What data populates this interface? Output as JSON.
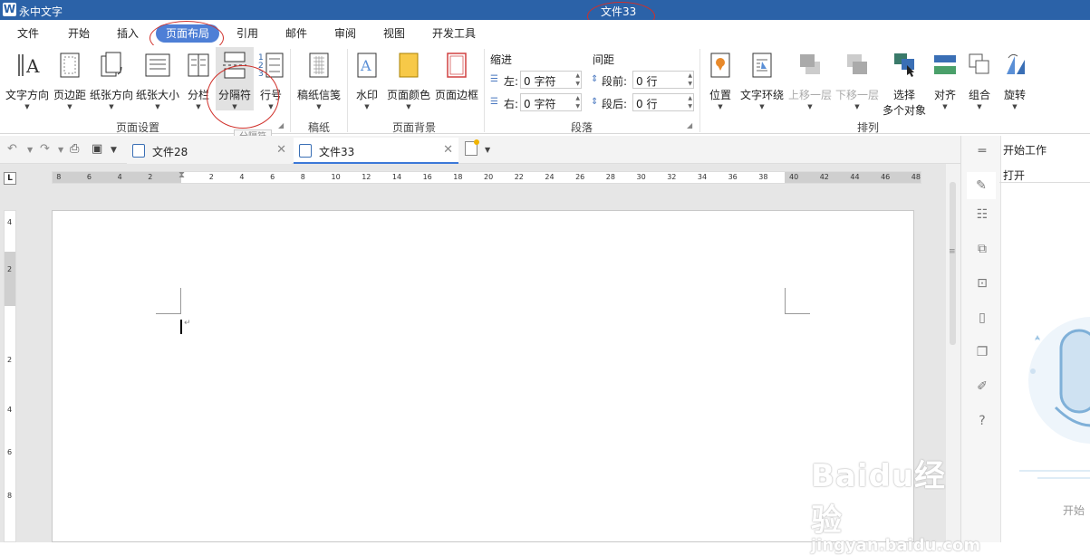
{
  "app": {
    "logo": "W",
    "name": "永中文字",
    "title": "文件33"
  },
  "menu": [
    "文件",
    "开始",
    "插入",
    "页面布局",
    "引用",
    "邮件",
    "审阅",
    "视图",
    "开发工具"
  ],
  "ribbon": {
    "page_setup": {
      "buttons": [
        "文字方向",
        "页边距",
        "纸张方向",
        "纸张大小",
        "分栏",
        "分隔符",
        "行号"
      ],
      "group": "页面设置"
    },
    "draft": {
      "buttons": [
        "稿纸信笺"
      ],
      "group": "稿纸"
    },
    "background": {
      "buttons": [
        "水印",
        "页面颜色",
        "页面边框"
      ],
      "group": "页面背景"
    },
    "paragraph": {
      "indent_label": "缩进",
      "spacing_label": "间距",
      "left_label": "左:",
      "left_value": "0 字符",
      "right_label": "右:",
      "right_value": "0 字符",
      "before_label": "段前:",
      "before_value": "0 行",
      "after_label": "段后:",
      "after_value": "0 行",
      "group": "段落"
    },
    "arrange": {
      "buttons": [
        "位置",
        "文字环绕",
        "上移一层",
        "下移一层"
      ],
      "select_line1": "选择",
      "select_line2": "多个对象",
      "buttons2": [
        "对齐",
        "组合",
        "旋转"
      ],
      "group": "排列"
    },
    "tooltip": "分隔符"
  },
  "tabs": [
    {
      "name": "文件28"
    },
    {
      "name": "文件33"
    }
  ],
  "ruler": {
    "h_ticks": [
      "8",
      "6",
      "4",
      "2",
      "2",
      "4",
      "6",
      "8",
      "10",
      "12",
      "14",
      "16",
      "18",
      "20",
      "22",
      "24",
      "26",
      "28",
      "30",
      "32",
      "34",
      "36",
      "38",
      "40",
      "42",
      "44",
      "46",
      "48"
    ],
    "v_ticks": [
      "4",
      "2",
      "2",
      "4",
      "6",
      "8"
    ]
  },
  "right_panel": {
    "title": "开始工作",
    "open": "打开",
    "start": "开始"
  },
  "watermark": {
    "big": "Baidu经验",
    "small": "jingyan.baidu.com"
  },
  "colors": {
    "titlebar": "#2b62a8",
    "active_menu": "#4e7fd6",
    "annotation": "#d0302a"
  }
}
